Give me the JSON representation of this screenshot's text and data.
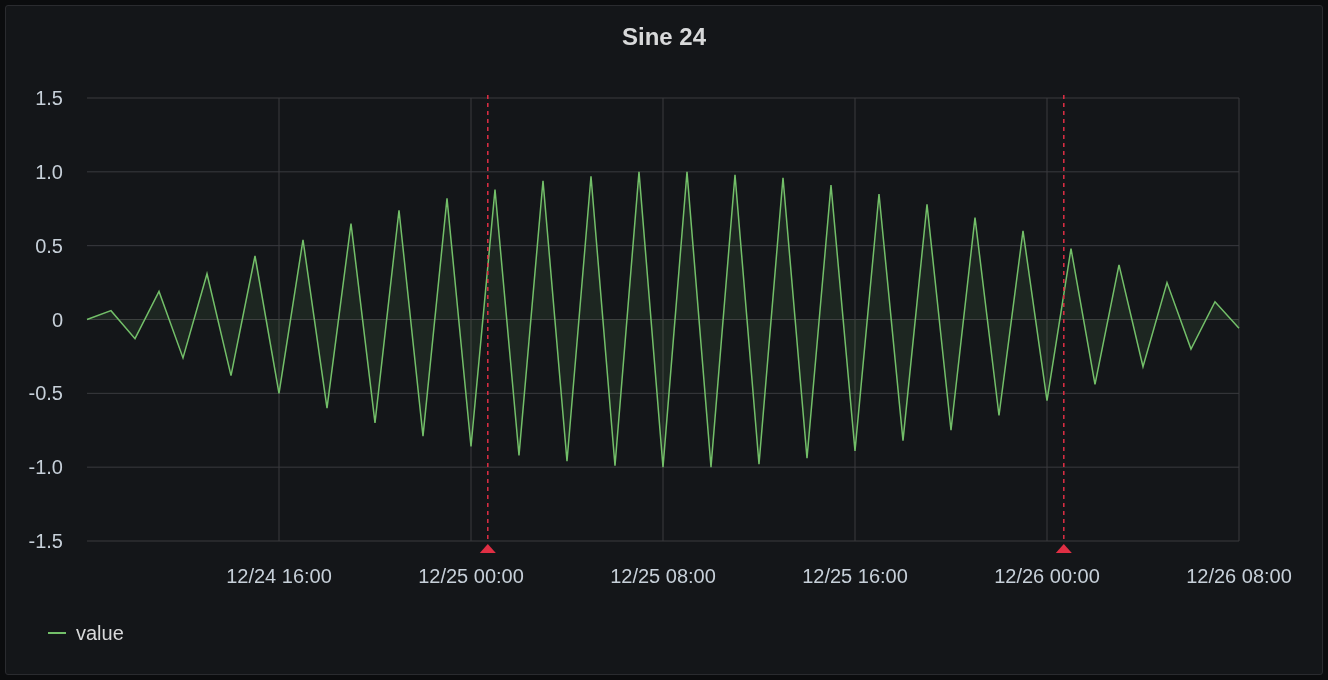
{
  "panel": {
    "title": "Sine 24",
    "chart_data": {
      "type": "area",
      "categories": [
        null,
        null,
        null,
        null,
        null,
        null,
        null,
        null,
        "12/24 16:00",
        null,
        null,
        null,
        null,
        null,
        null,
        null,
        "12/25 00:00",
        null,
        null,
        null,
        null,
        null,
        null,
        null,
        "12/25 08:00",
        null,
        null,
        null,
        null,
        null,
        null,
        null,
        "12/25 16:00",
        null,
        null,
        null,
        null,
        null,
        null,
        null,
        "12/26 00:00",
        null,
        null,
        null,
        null,
        null,
        null,
        null,
        "12/26 08:00"
      ],
      "series": [
        {
          "name": "value",
          "color": "#73bf69",
          "values": [
            0,
            0.06,
            -0.13,
            0.19,
            -0.26,
            0.31,
            -0.38,
            0.43,
            -0.5,
            0.54,
            -0.6,
            0.65,
            -0.7,
            0.74,
            -0.79,
            0.82,
            -0.86,
            0.88,
            -0.92,
            0.94,
            -0.96,
            0.97,
            -0.99,
            1.0,
            -1.0,
            1.0,
            -1.0,
            0.98,
            -0.98,
            0.96,
            -0.94,
            0.91,
            -0.89,
            0.85,
            -0.82,
            0.78,
            -0.75,
            0.69,
            -0.65,
            0.6,
            -0.55,
            0.48,
            -0.44,
            0.37,
            -0.32,
            0.25,
            -0.2,
            0.12,
            -0.06
          ]
        }
      ],
      "ylim": [
        -1.5,
        1.5
      ],
      "yticks": [
        {
          "value": 1.5,
          "label": "1.5"
        },
        {
          "value": 1,
          "label": "1.0"
        },
        {
          "value": 0.5,
          "label": "0.5"
        },
        {
          "value": 0,
          "label": "0"
        },
        {
          "value": -0.5,
          "label": "-0.5"
        },
        {
          "value": -1,
          "label": "-1.0"
        },
        {
          "value": -1.5,
          "label": "-1.5"
        }
      ],
      "grid": true,
      "annotations": [
        {
          "x": "12/25 00:00"
        },
        {
          "x": "12/26 00:00"
        }
      ]
    }
  }
}
